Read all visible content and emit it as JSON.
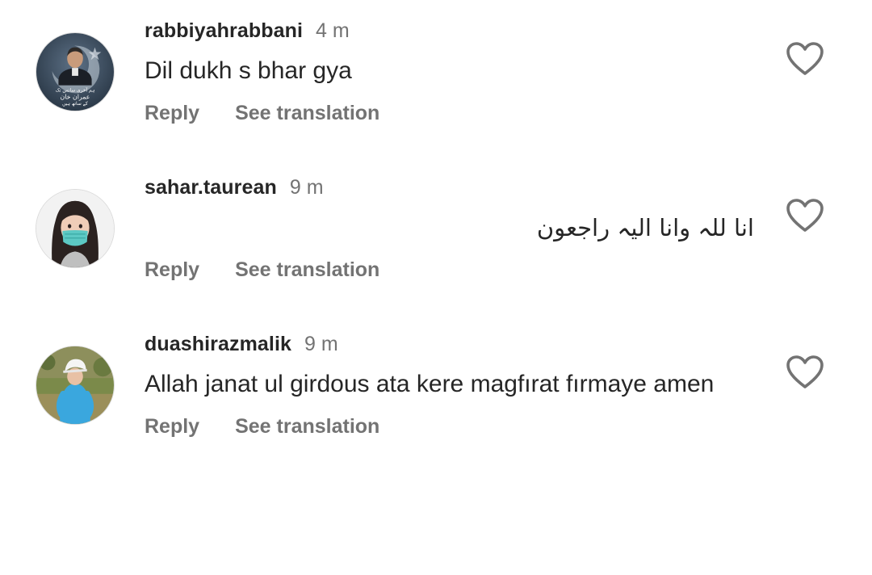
{
  "comments": [
    {
      "username": "rabbiyahrabbani",
      "time": "4 m",
      "text": "Dil dukh s bhar gya",
      "reply_label": "Reply",
      "translate_label": "See translation",
      "avatar_caption": [
        "ہم آخری سانس تک",
        "عمران خان",
        "کے ساتھ ہیں"
      ],
      "avatar_icon": "portrait-flag-avatar"
    },
    {
      "username": "sahar.taurean",
      "time": "9 m",
      "text": "انا للہ وانا الیہ راجعون",
      "reply_label": "Reply",
      "translate_label": "See translation",
      "avatar_icon": "masked-girl-avatar"
    },
    {
      "username": "duashirazmalik",
      "time": "9 m",
      "text": "Allah janat ul girdous ata kere magfırat fırmaye amen",
      "reply_label": "Reply",
      "translate_label": "See translation",
      "avatar_icon": "child-photo-avatar"
    }
  ],
  "like_icon": "heart-outline-icon",
  "colors": {
    "text": "#262626",
    "secondary": "#737373",
    "background": "#ffffff"
  }
}
